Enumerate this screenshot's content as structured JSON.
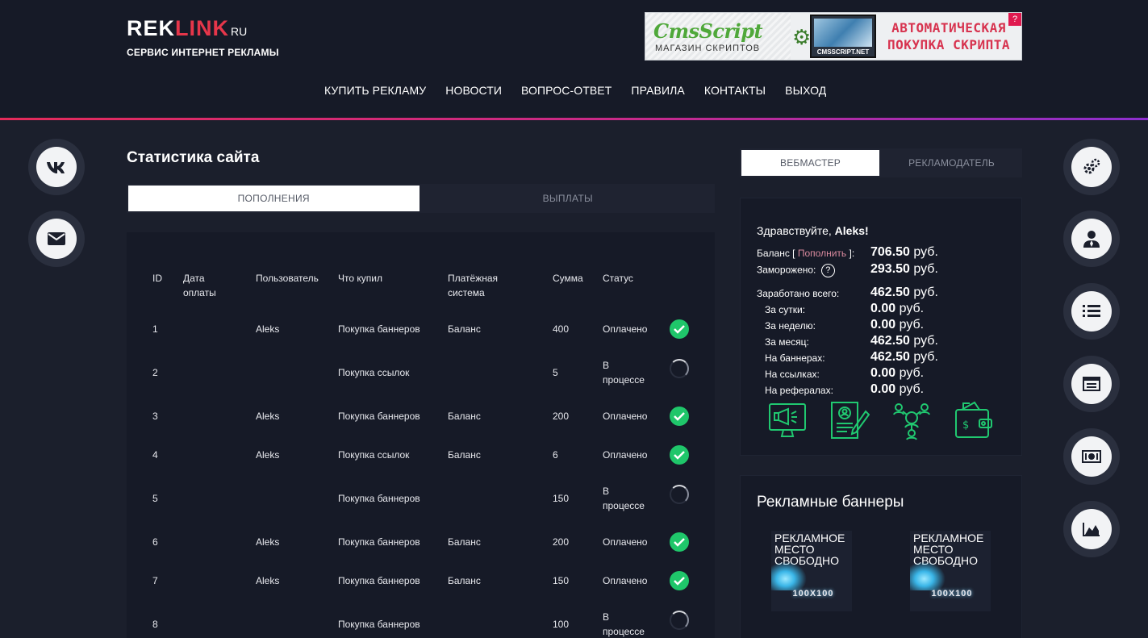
{
  "header": {
    "logo": {
      "part1": "REK",
      "part2": "LINK",
      "suffix": "RU"
    },
    "subtitle": "СЕРВИС ИНТЕРНЕТ РЕКЛАМЫ",
    "ad": {
      "brand": "CmsScript",
      "shop": "МАГАЗИН СКРИПТОВ",
      "monitor_caption": "CMSSCRIPT.NET",
      "headline_1": "АВТОМАТИЧЕСКАЯ",
      "headline_2": "ПОКУПКА СКРИПТА",
      "badge": "?"
    },
    "nav": [
      "КУПИТЬ РЕКЛАМУ",
      "НОВОСТИ",
      "ВОПРОС-ОТВЕТ",
      "ПРАВИЛА",
      "КОНТАКТЫ",
      "ВЫХОД"
    ]
  },
  "left_social": [
    "vk-icon",
    "mail-icon"
  ],
  "right_menu": [
    "settings-icon",
    "user-icon",
    "list-icon",
    "browser-icon",
    "money-icon",
    "chart-icon"
  ],
  "main": {
    "title": "Статистика сайта",
    "tabs": [
      "ПОПОЛНЕНИЯ",
      "ВЫПЛАТЫ"
    ],
    "columns": [
      "ID",
      "Дата оплаты",
      "Пользователь",
      "Что купил",
      "Платёжная система",
      "Сумма",
      "Статус"
    ],
    "rows": [
      {
        "id": "1",
        "date": "",
        "user": "Aleks",
        "item": "Покупка баннеров",
        "system": "Баланс",
        "sum": "400",
        "status": "Оплачено",
        "state": "paid"
      },
      {
        "id": "2",
        "date": "",
        "user": "",
        "item": "Покупка ссылок",
        "system": "",
        "sum": "5",
        "status": "В процессе",
        "state": "pending"
      },
      {
        "id": "3",
        "date": "",
        "user": "Aleks",
        "item": "Покупка баннеров",
        "system": "Баланс",
        "sum": "200",
        "status": "Оплачено",
        "state": "paid"
      },
      {
        "id": "4",
        "date": "",
        "user": "Aleks",
        "item": "Покупка ссылок",
        "system": "Баланс",
        "sum": "6",
        "status": "Оплачено",
        "state": "paid"
      },
      {
        "id": "5",
        "date": "",
        "user": "",
        "item": "Покупка баннеров",
        "system": "",
        "sum": "150",
        "status": "В процессе",
        "state": "pending"
      },
      {
        "id": "6",
        "date": "",
        "user": "Aleks",
        "item": "Покупка баннеров",
        "system": "Баланс",
        "sum": "200",
        "status": "Оплачено",
        "state": "paid"
      },
      {
        "id": "7",
        "date": "",
        "user": "Aleks",
        "item": "Покупка баннеров",
        "system": "Баланс",
        "sum": "150",
        "status": "Оплачено",
        "state": "paid"
      },
      {
        "id": "8",
        "date": "",
        "user": "",
        "item": "Покупка баннеров",
        "system": "",
        "sum": "100",
        "status": "В процессе",
        "state": "pending"
      }
    ]
  },
  "sidebar": {
    "tabs": [
      "ВЕБМАСТЕР",
      "РЕКЛАМОДАТЕЛЬ"
    ],
    "greeting": "Здравствуйте,",
    "username": "Aleks!",
    "balance_label_pre": "Баланс [",
    "balance_link": "Пополнить",
    "balance_label_post": "]:",
    "balance_value": "706.50",
    "frozen_label": "Заморожено:",
    "frozen_help": "?",
    "frozen_value": "293.50",
    "currency": "руб.",
    "earned_label": "Заработано всего:",
    "earned_value": "462.50",
    "stats": [
      {
        "label": "За сутки:",
        "value": "0.00"
      },
      {
        "label": "За неделю:",
        "value": "0.00"
      },
      {
        "label": "За месяц:",
        "value": "462.50"
      },
      {
        "label": "На баннерах:",
        "value": "462.50"
      },
      {
        "label": "На ссылках:",
        "value": "0.00"
      },
      {
        "label": "На рефералах:",
        "value": "0.00"
      }
    ],
    "action_icons": [
      "monitor-ad-icon",
      "resume-edit-icon",
      "referral-network-icon",
      "wallet-icon"
    ],
    "banners_title": "Рекламные баннеры",
    "banner_slots": [
      {
        "line1": "РЕКЛАМНОЕ",
        "line2": "МЕСТО",
        "line3": "СВОБОДНО",
        "size": "100X100"
      },
      {
        "line1": "РЕКЛАМНОЕ",
        "line2": "МЕСТО",
        "line3": "СВОБОДНО",
        "size": "100X100"
      }
    ]
  },
  "colors": {
    "background": "#1b1f2c",
    "header": "#161a27",
    "accent_red": "#e6364a",
    "accent_purple": "#8d2fcf",
    "success": "#1fc66a",
    "icon_green": "#20c870"
  }
}
